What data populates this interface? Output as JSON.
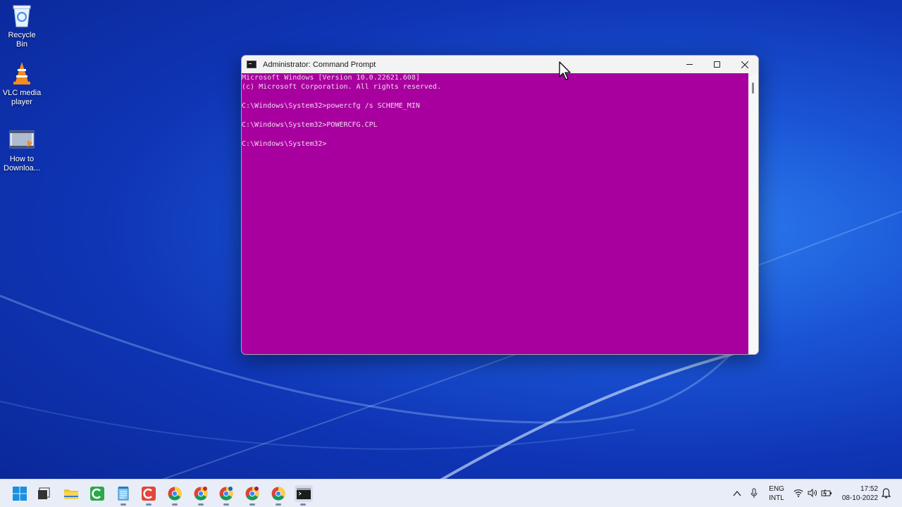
{
  "desktop": {
    "icons": [
      {
        "label": "Recycle Bin"
      },
      {
        "label": "VLC media\nplayer"
      },
      {
        "label": "How to\nDownloa..."
      }
    ]
  },
  "window": {
    "title": "Administrator: Command Prompt",
    "controls": {
      "minimize": "—",
      "maximize": "☐",
      "close": "✕"
    },
    "console_lines": [
      "Microsoft Windows [Version 10.0.22621.608]",
      "(c) Microsoft Corporation. All rights reserved.",
      "",
      "C:\\Windows\\System32>powercfg /s SCHEME_MIN",
      "",
      "C:\\Windows\\System32>POWERCFG.CPL",
      "",
      "C:\\Windows\\System32>"
    ]
  },
  "taskbar": {
    "apps": [
      {
        "icon": "windows-start-icon"
      },
      {
        "icon": "task-view-icon"
      },
      {
        "icon": "file-explorer-icon"
      },
      {
        "icon": "camtasia-icon"
      },
      {
        "icon": "notepad-icon"
      },
      {
        "icon": "camtasia-recorder-icon"
      },
      {
        "icon": "chrome-icon"
      },
      {
        "icon": "chrome-icon"
      },
      {
        "icon": "chrome-icon"
      },
      {
        "icon": "chrome-icon"
      },
      {
        "icon": "chrome-icon"
      },
      {
        "icon": "command-prompt-icon"
      }
    ],
    "tray": {
      "lang_top": "ENG",
      "lang_bottom": "INTL",
      "time": "17:52",
      "date": "08-10-2022"
    }
  },
  "colors": {
    "console_bg": "#a8009e",
    "console_fg": "#f1d6ef"
  }
}
